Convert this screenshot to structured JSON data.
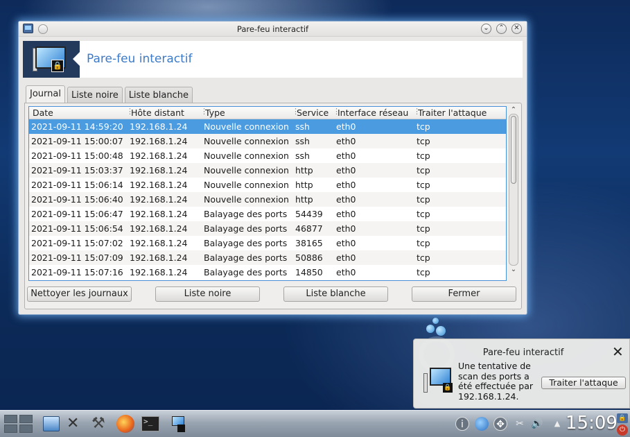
{
  "window": {
    "title": "Pare-feu interactif",
    "banner_title": "Pare-feu interactif",
    "minimize_icon": "chevron-down-icon",
    "maximize_icon": "chevron-up-icon",
    "close_icon": "close-icon"
  },
  "tabs": [
    {
      "label": "Journal",
      "active": true
    },
    {
      "label": "Liste noire",
      "active": false
    },
    {
      "label": "Liste blanche",
      "active": false
    }
  ],
  "table": {
    "columns": [
      "Date",
      "Hôte distant",
      "Type",
      "Service",
      "Interface réseau",
      "Traiter l'attaque"
    ],
    "rows": [
      [
        "2021-09-11 14:59:20",
        "192.168.1.24",
        "Nouvelle connexion",
        "ssh",
        "eth0",
        "tcp"
      ],
      [
        "2021-09-11 15:00:07",
        "192.168.1.24",
        "Nouvelle connexion",
        "ssh",
        "eth0",
        "tcp"
      ],
      [
        "2021-09-11 15:00:48",
        "192.168.1.24",
        "Nouvelle connexion",
        "ssh",
        "eth0",
        "tcp"
      ],
      [
        "2021-09-11 15:03:37",
        "192.168.1.24",
        "Nouvelle connexion",
        "http",
        "eth0",
        "tcp"
      ],
      [
        "2021-09-11 15:06:14",
        "192.168.1.24",
        "Nouvelle connexion",
        "http",
        "eth0",
        "tcp"
      ],
      [
        "2021-09-11 15:06:40",
        "192.168.1.24",
        "Nouvelle connexion",
        "http",
        "eth0",
        "tcp"
      ],
      [
        "2021-09-11 15:06:47",
        "192.168.1.24",
        "Balayage des ports",
        "54439",
        "eth0",
        "tcp"
      ],
      [
        "2021-09-11 15:06:54",
        "192.168.1.24",
        "Balayage des ports",
        "46877",
        "eth0",
        "tcp"
      ],
      [
        "2021-09-11 15:07:02",
        "192.168.1.24",
        "Balayage des ports",
        "38165",
        "eth0",
        "tcp"
      ],
      [
        "2021-09-11 15:07:09",
        "192.168.1.24",
        "Balayage des ports",
        "50886",
        "eth0",
        "tcp"
      ],
      [
        "2021-09-11 15:07:16",
        "192.168.1.24",
        "Balayage des ports",
        "14850",
        "eth0",
        "tcp"
      ]
    ],
    "selected_row": 0
  },
  "buttons": {
    "clear_logs": "Nettoyer les journaux",
    "blacklist": "Liste noire",
    "whitelist": "Liste blanche",
    "close": "Fermer"
  },
  "notification": {
    "title": "Pare-feu interactif",
    "message": "Une tentative de scan des ports a été effectuée par 192.168.1.24.",
    "action_label": "Traiter l'attaque"
  },
  "taskbar": {
    "clock": "15:09",
    "launchers": [
      "file-manager-icon",
      "settings-tools-icon",
      "software-install-icon",
      "firefox-icon",
      "terminal-icon",
      "firewall-icon"
    ],
    "tray": [
      "info-icon",
      "network-icon",
      "move-icon",
      "clipboard-icon",
      "volume-icon",
      "expand-tray-icon"
    ]
  },
  "colors": {
    "selection": "#4a9be0",
    "banner_title": "#3d7ac6",
    "window_glow": "#78beff"
  }
}
